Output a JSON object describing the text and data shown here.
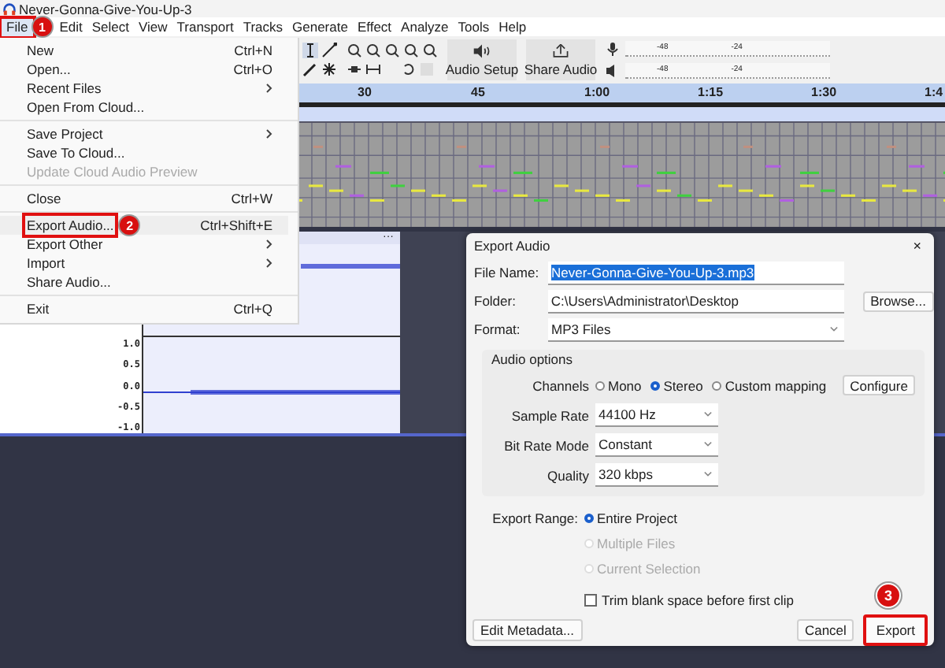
{
  "window": {
    "title": "Never-Gonna-Give-You-Up-3"
  },
  "menu": [
    {
      "label": "File",
      "selected": true,
      "highlighted": true
    },
    {
      "label": "Edit",
      "selected": false,
      "highlighted": false
    },
    {
      "label": "Select",
      "selected": false,
      "highlighted": false
    },
    {
      "label": "View",
      "selected": false,
      "highlighted": false
    },
    {
      "label": "Transport",
      "selected": false,
      "highlighted": false
    },
    {
      "label": "Tracks",
      "selected": false,
      "highlighted": false
    },
    {
      "label": "Generate",
      "selected": false,
      "highlighted": false
    },
    {
      "label": "Effect",
      "selected": false,
      "highlighted": false
    },
    {
      "label": "Analyze",
      "selected": false,
      "highlighted": false
    },
    {
      "label": "Tools",
      "selected": false,
      "highlighted": false
    },
    {
      "label": "Help",
      "selected": false,
      "highlighted": false
    }
  ],
  "toolbar": {
    "audio_setup": "Audio Setup",
    "share_audio": "Share Audio",
    "meters": [
      {
        "labels": [
          "-48",
          "-24"
        ]
      },
      {
        "labels": [
          "-48",
          "-24"
        ]
      }
    ]
  },
  "ruler": {
    "labels": [
      "30",
      "45",
      "1:00",
      "1:15",
      "1:30",
      "1:4"
    ]
  },
  "audio_track": {
    "scale": [
      "1.0",
      "0.5",
      "0.0",
      "-0.5",
      "-1.0"
    ],
    "clip_menu": "···"
  },
  "file_menu": {
    "groups": [
      [
        {
          "label": "New",
          "shortcut": "Ctrl+N",
          "submenu": false,
          "disabled": false,
          "highlighted": false
        },
        {
          "label": "Open...",
          "shortcut": "Ctrl+O",
          "submenu": false,
          "disabled": false,
          "highlighted": false
        },
        {
          "label": "Recent Files",
          "submenu": true,
          "disabled": false,
          "highlighted": false
        },
        {
          "label": "Open From Cloud...",
          "submenu": false,
          "disabled": false,
          "highlighted": false
        }
      ],
      [
        {
          "label": "Save Project",
          "submenu": true,
          "disabled": false,
          "highlighted": false
        },
        {
          "label": "Save To Cloud...",
          "submenu": false,
          "disabled": false,
          "highlighted": false
        },
        {
          "label": "Update Cloud Audio Preview",
          "submenu": false,
          "disabled": true,
          "highlighted": false
        }
      ],
      [
        {
          "label": "Close",
          "shortcut": "Ctrl+W",
          "submenu": false,
          "disabled": false,
          "highlighted": false
        }
      ],
      [
        {
          "label": "Export Audio...",
          "shortcut": "Ctrl+Shift+E",
          "submenu": false,
          "disabled": false,
          "highlighted": true
        },
        {
          "label": "Export Other",
          "submenu": true,
          "disabled": false,
          "highlighted": false
        },
        {
          "label": "Import",
          "submenu": true,
          "disabled": false,
          "highlighted": false
        },
        {
          "label": "Share Audio...",
          "submenu": false,
          "disabled": false,
          "highlighted": false
        }
      ],
      [
        {
          "label": "Exit",
          "shortcut": "Ctrl+Q",
          "submenu": false,
          "disabled": false,
          "highlighted": false
        }
      ]
    ]
  },
  "dialog": {
    "title": "Export Audio",
    "close": "×",
    "file_name": {
      "label": "File Name:",
      "value": "Never-Gonna-Give-You-Up-3.mp3"
    },
    "folder": {
      "label": "Folder:",
      "value": "C:\\Users\\Administrator\\Desktop",
      "button": "Browse..."
    },
    "format": {
      "label": "Format:",
      "value": "MP3 Files"
    },
    "audio_options": {
      "heading": "Audio options",
      "channels_label": "Channels",
      "channels": [
        {
          "label": "Mono",
          "selected": false
        },
        {
          "label": "Stereo",
          "selected": true
        },
        {
          "label": "Custom mapping",
          "selected": false
        }
      ],
      "configure": "Configure",
      "selects": [
        {
          "label": "Sample Rate",
          "value": "44100 Hz"
        },
        {
          "label": "Bit Rate Mode",
          "value": "Constant"
        },
        {
          "label": "Quality",
          "value": "320 kbps"
        }
      ]
    },
    "export_range": {
      "label": "Export Range:",
      "options": [
        {
          "label": "Entire Project",
          "selected": true,
          "disabled": false
        },
        {
          "label": "Multiple Files",
          "selected": false,
          "disabled": true
        },
        {
          "label": "Current Selection",
          "selected": false,
          "disabled": true
        }
      ]
    },
    "trim": {
      "label": "Trim blank space before first clip",
      "checked": false
    },
    "buttons": [
      {
        "label": "Edit Metadata...",
        "highlighted": false
      },
      {
        "label": "Cancel",
        "highlighted": false
      },
      {
        "label": "Export",
        "highlighted": true
      }
    ]
  },
  "steps": [
    "1",
    "2",
    "3"
  ]
}
